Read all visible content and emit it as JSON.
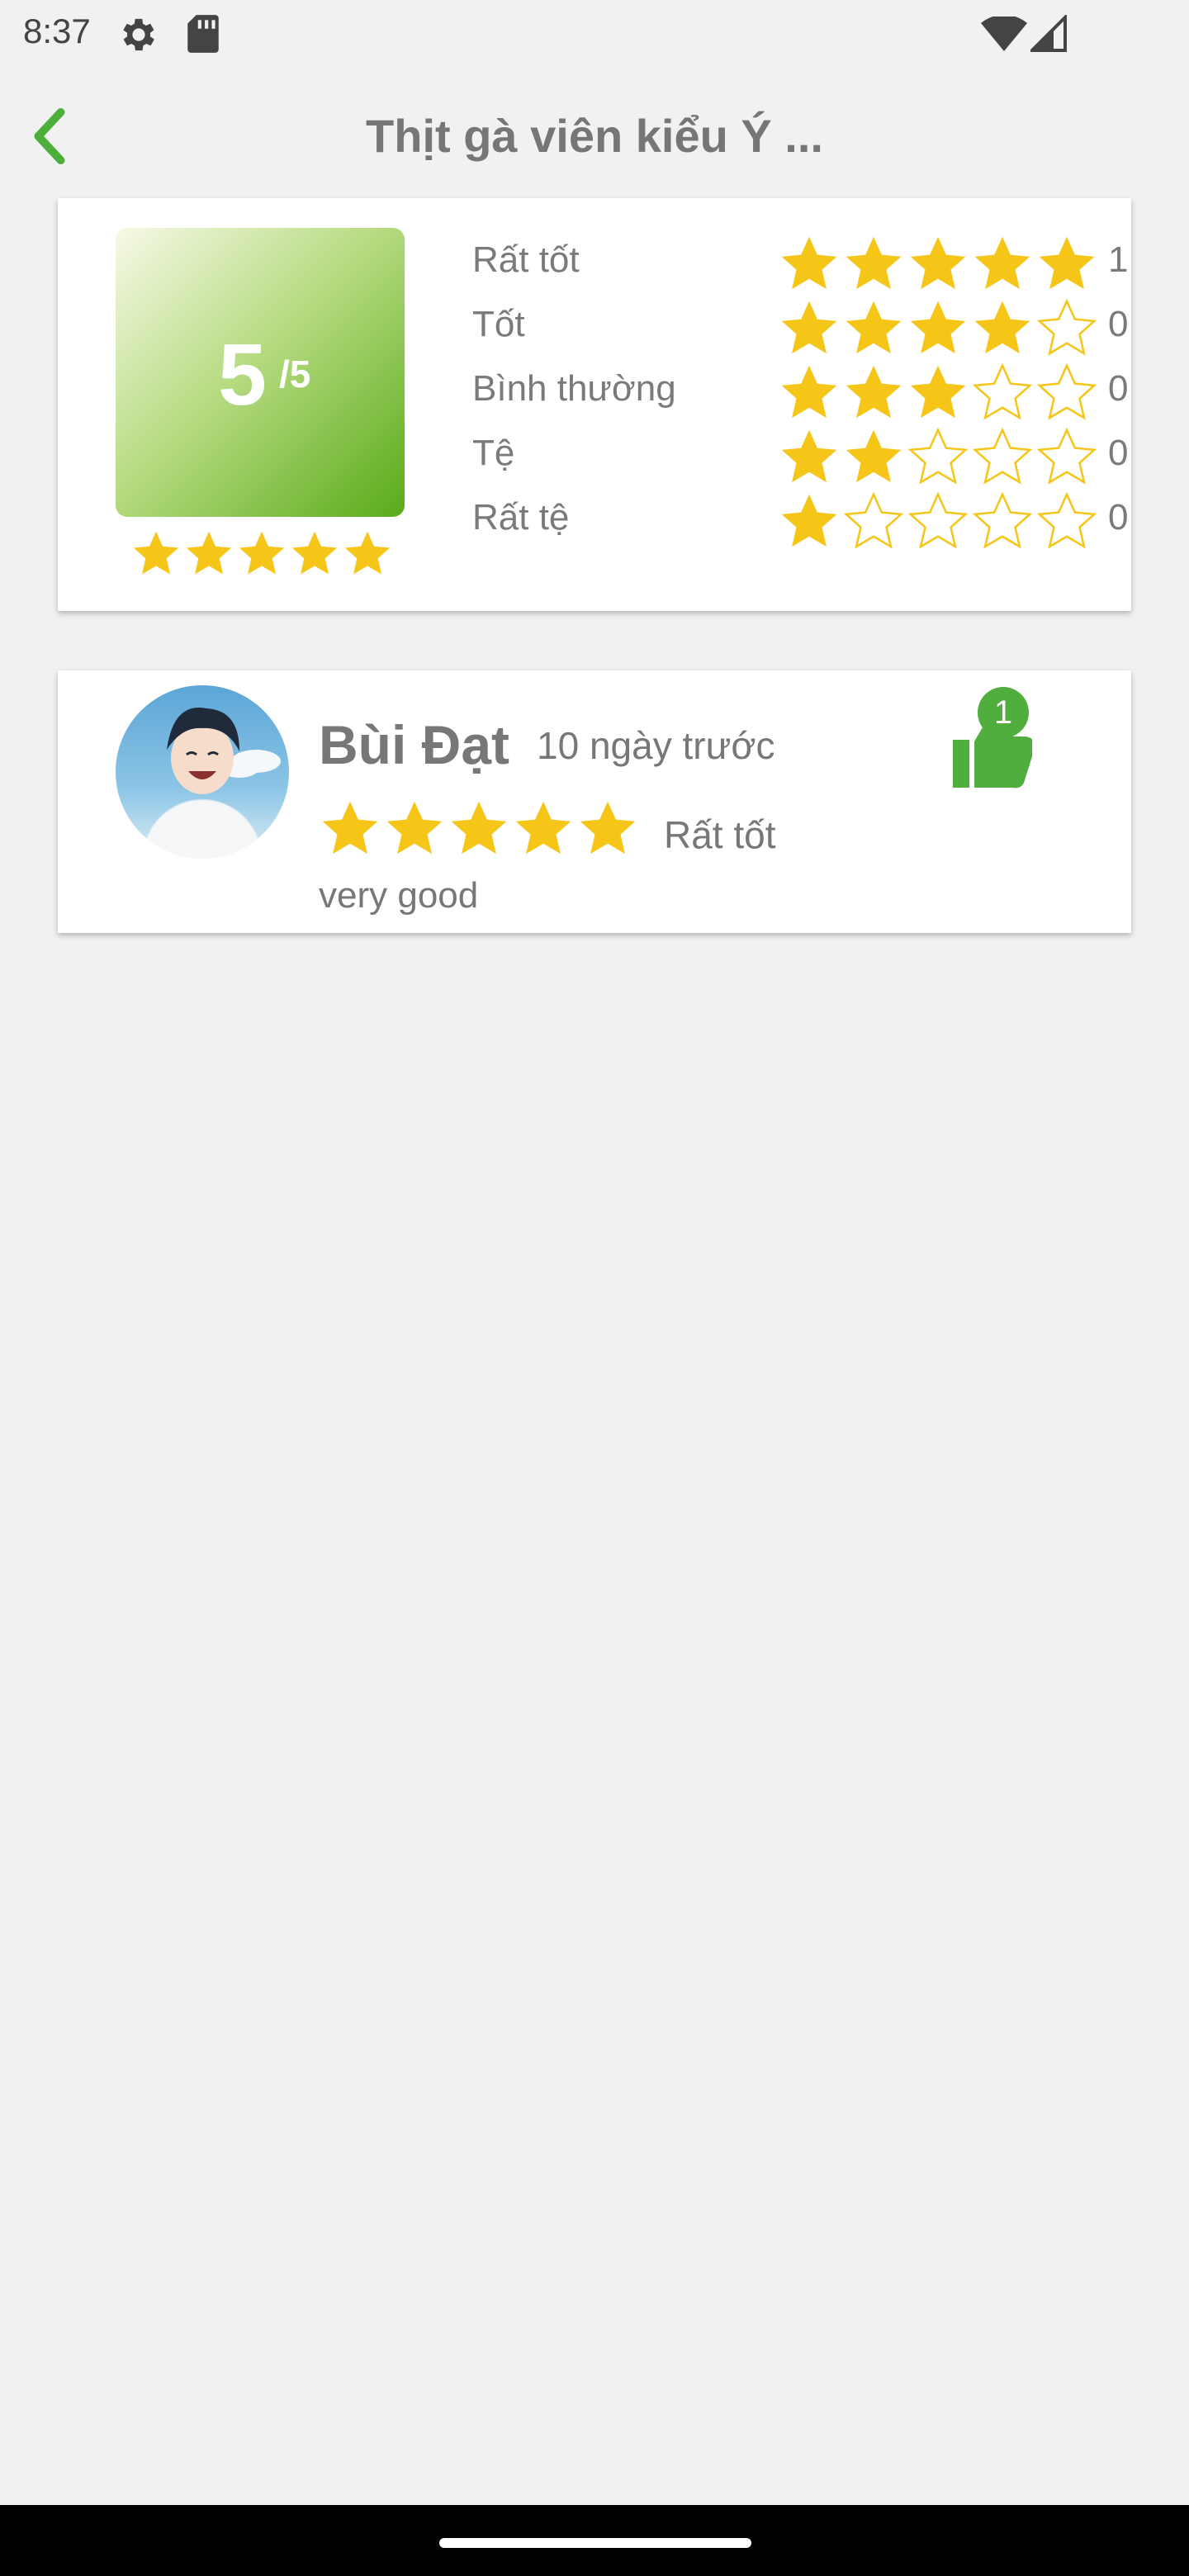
{
  "status_bar": {
    "time": "8:37",
    "icons": [
      "gear-icon",
      "sd-card-icon",
      "wifi-icon",
      "signal-icon"
    ]
  },
  "app_bar": {
    "title": "Thịt gà viên kiểu Ý ...",
    "back_icon": "chevron-left-icon"
  },
  "summary": {
    "score": "5",
    "score_max": "/5",
    "score_stars": 5,
    "distribution": [
      {
        "label": "Rất tốt",
        "stars": 5,
        "count": "1"
      },
      {
        "label": "Tốt",
        "stars": 4,
        "count": "0"
      },
      {
        "label": "Bình thường",
        "stars": 3,
        "count": "0"
      },
      {
        "label": "Tệ",
        "stars": 2,
        "count": "0"
      },
      {
        "label": "Rất tệ",
        "stars": 1,
        "count": "0"
      }
    ]
  },
  "reviews": [
    {
      "name": "Bùi Đạt",
      "time": "10 ngày trước",
      "stars": 5,
      "rating_text": "Rất tốt",
      "comment": "very good",
      "likes": "1"
    }
  ],
  "colors": {
    "accent_green": "#4fae3d",
    "star_yellow": "#f5c518",
    "text_gray": "#777777",
    "background": "#f1f1f1"
  }
}
